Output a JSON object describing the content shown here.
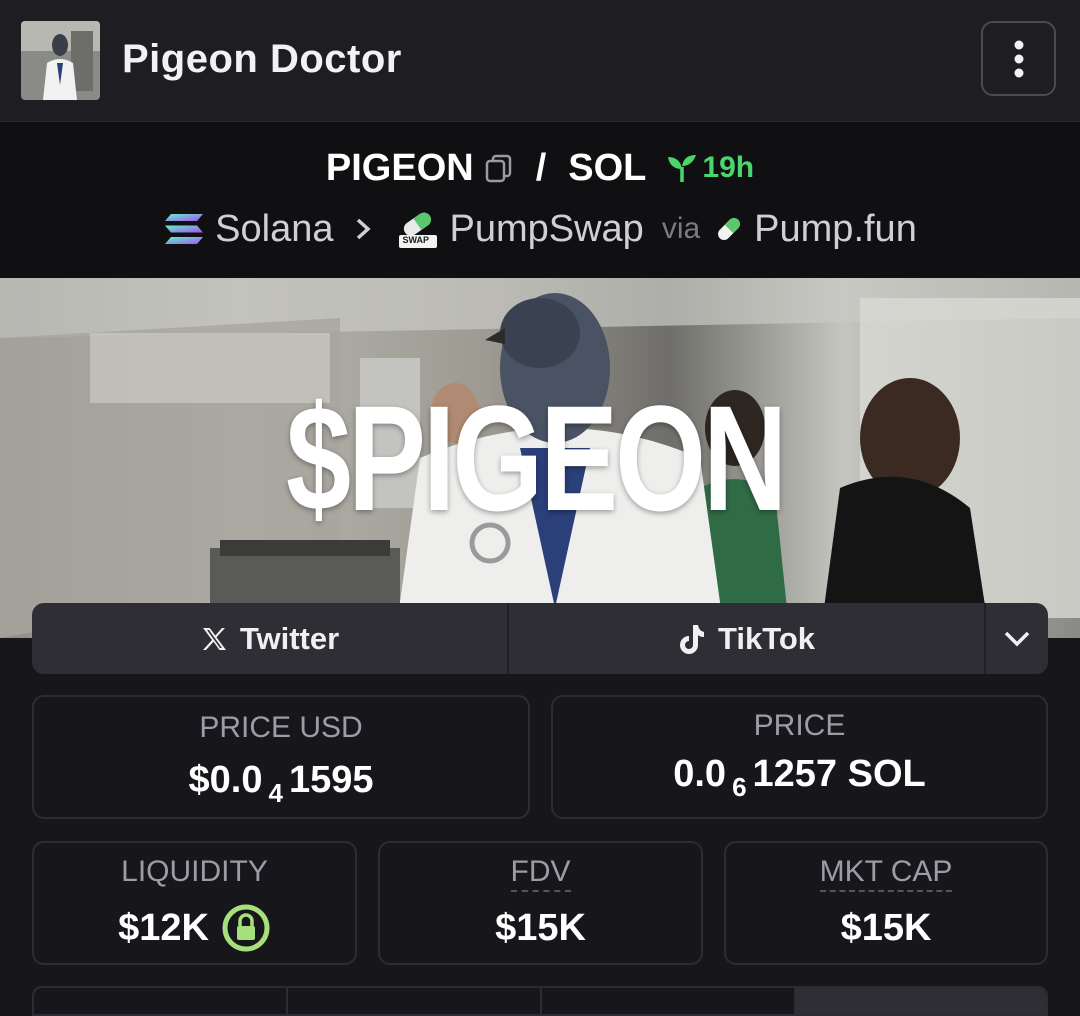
{
  "header": {
    "title": "Pigeon Doctor"
  },
  "pair": {
    "base": "PIGEON",
    "separator": "/",
    "quote": "SOL",
    "age": "19h",
    "chain": "Solana",
    "dex": "PumpSwap",
    "dex_badge": "SWAP",
    "via": "via",
    "launchpad": "Pump.fun"
  },
  "banner": {
    "text": "$PIGEON"
  },
  "social": {
    "twitter": "Twitter",
    "tiktok": "TikTok"
  },
  "stats": {
    "price_usd_label": "PRICE USD",
    "price_usd_prefix": "$0.0",
    "price_usd_zeros": "4",
    "price_usd_digits": "1595",
    "price_label": "PRICE",
    "price_prefix": "0.0",
    "price_zeros": "6",
    "price_digits": "1257 SOL",
    "liquidity_label": "LIQUIDITY",
    "liquidity_value": "$12K",
    "fdv_label": "FDV",
    "fdv_value": "$15K",
    "mktcap_label": "MKT CAP",
    "mktcap_value": "$15K"
  },
  "colors": {
    "accent_green": "#4ad66d",
    "lock_green": "#a7e07a"
  }
}
